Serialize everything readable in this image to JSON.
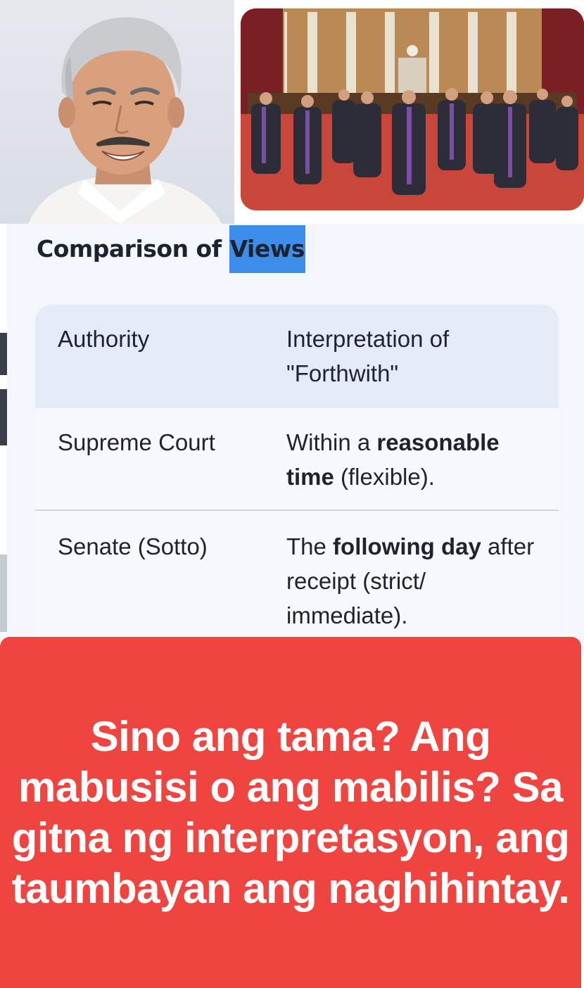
{
  "photos": {
    "portrait": "portrait-photo",
    "court": "supreme-court-justices-photo"
  },
  "card": {
    "title_prefix": "Comparison of ",
    "title_highlight": "Views",
    "table": {
      "headers": [
        "Authority",
        "Interpretation of \"Forthwith\""
      ],
      "rows": [
        {
          "authority": "Supreme Court",
          "interp_pre": "Within a ",
          "interp_bold": "reasonable time",
          "interp_post": " (flexible)."
        },
        {
          "authority": "Senate (Sotto)",
          "interp_pre": "The ",
          "interp_bold": "following day",
          "interp_post": " after receipt (strict/ immediate)."
        }
      ]
    }
  },
  "caption": "Sino ang tama? Ang mabusisi o ang mabilis? Sa gitna ng interpretasyon, ang taumbayan ang naghihintay.",
  "colors": {
    "banner": "#ef4440",
    "highlight": "#3d8eea",
    "card_bg": "#f3f6fc",
    "table_header_bg": "#e4ebf7"
  }
}
